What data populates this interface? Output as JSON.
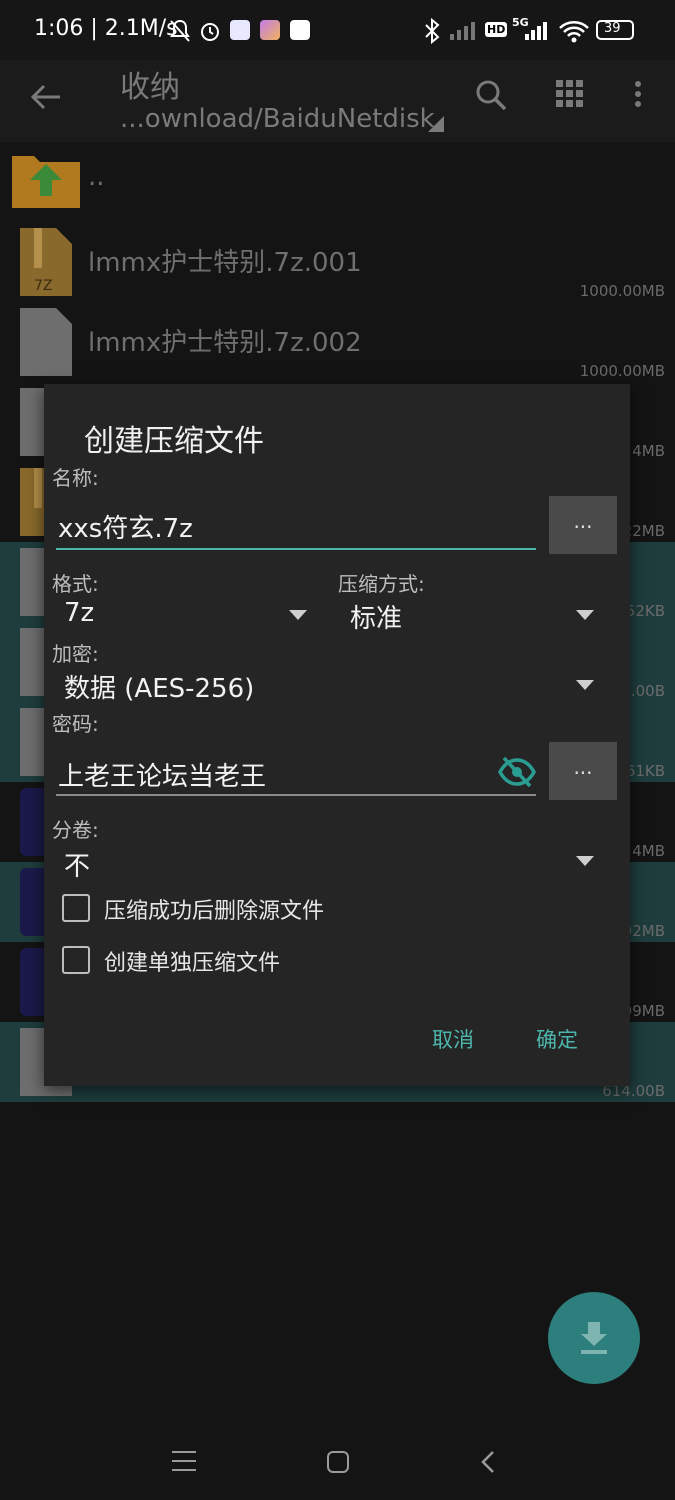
{
  "status_bar": {
    "time": "1:06 | 2.1M/s",
    "battery": "39",
    "signal_badge_hd": "HD",
    "signal_badge_5g": "5G"
  },
  "toolbar": {
    "title": "收纳",
    "path": "...ownload/BaiduNetdisk"
  },
  "file_list": [
    {
      "name": "..",
      "size": "",
      "icon": "folder-up-icon"
    },
    {
      "name": "lmmx护士特别.7z.001",
      "size": "1000.00MB",
      "icon": "archive-7z-icon"
    },
    {
      "name": "lmmx护士特别.7z.002",
      "size": "1000.00MB",
      "icon": "file-icon"
    },
    {
      "name": "",
      "size": "4MB",
      "icon": "file-icon"
    },
    {
      "name": "",
      "size": "22MB",
      "icon": "archive-icon"
    },
    {
      "name": "",
      "size": "52KB",
      "icon": "doc-icon"
    },
    {
      "name": "",
      "size": "6.00B",
      "icon": "doc-icon"
    },
    {
      "name": "",
      "size": "61KB",
      "icon": "doc-icon"
    },
    {
      "name": "",
      "size": "4MB",
      "icon": "app-icon"
    },
    {
      "name": "",
      "size": "92MB",
      "icon": "app-icon"
    },
    {
      "name": "",
      "size": "99MB",
      "icon": "app-icon"
    },
    {
      "name": "",
      "size": "614.00B",
      "icon": "doc-icon"
    }
  ],
  "dialog": {
    "title": "创建压缩文件",
    "name_label": "名称:",
    "name_value": "xxs符玄.7z",
    "ellipsis": "...",
    "format_label": "格式:",
    "format_value": "7z",
    "method_label": "压缩方式:",
    "method_value": "标准",
    "encrypt_label": "加密:",
    "encrypt_value": "数据 (AES-256)",
    "password_label": "密码:",
    "password_value": "上老王论坛当老王",
    "split_label": "分卷:",
    "split_value": "不",
    "delete_source_label": "压缩成功后删除源文件",
    "separate_label": "创建单独压缩文件",
    "cancel": "取消",
    "ok": "确定"
  },
  "colors": {
    "accent": "#4db6ac",
    "dialog_bg": "#252525",
    "highlight_row": "#1f3d3d"
  }
}
